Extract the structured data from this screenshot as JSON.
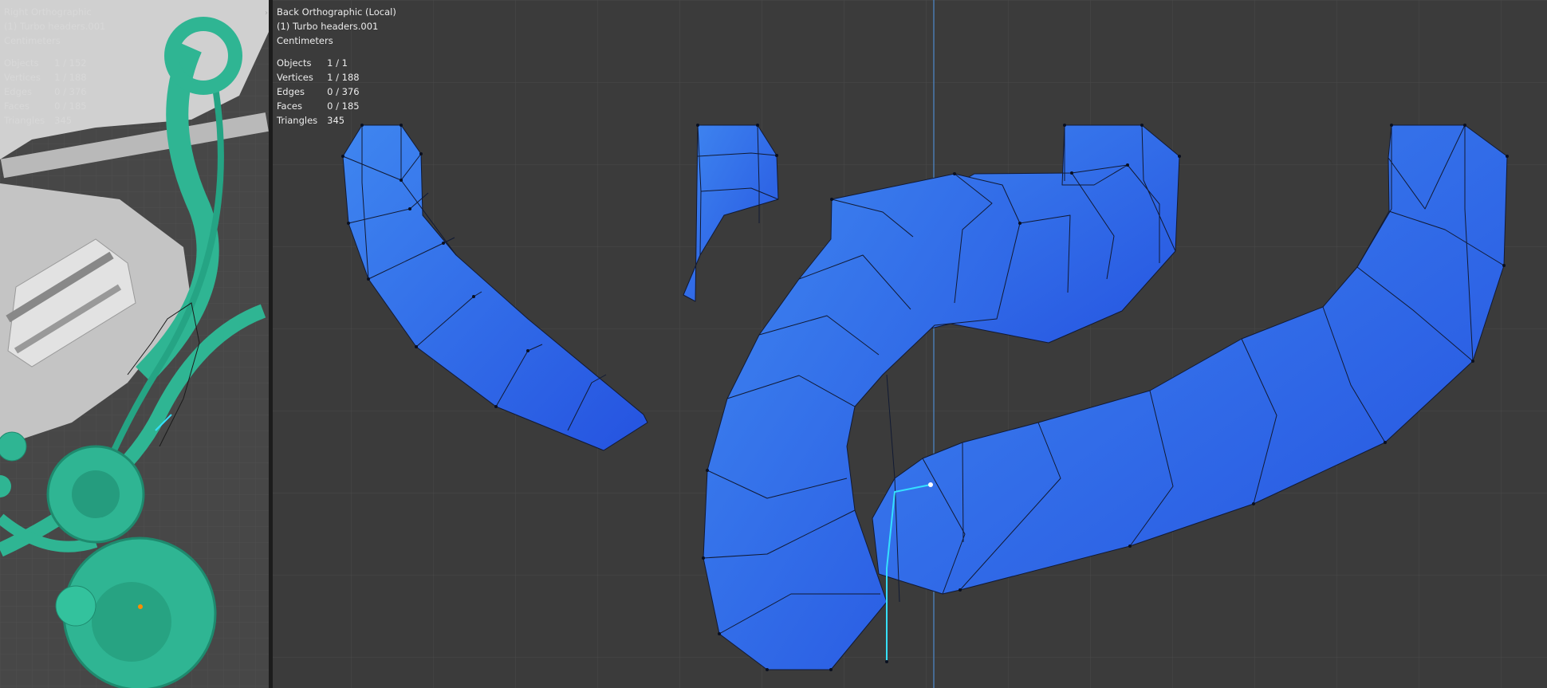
{
  "left_viewport": {
    "view_name": "Right Orthographic",
    "object_name": "(1) Turbo headers.001",
    "units": "Centimeters",
    "stats": [
      {
        "label": "Objects",
        "value": "1 / 152"
      },
      {
        "label": "Vertices",
        "value": "1 / 188"
      },
      {
        "label": "Edges",
        "value": "0 / 376"
      },
      {
        "label": "Faces",
        "value": "0 / 185"
      },
      {
        "label": "Triangles",
        "value": "345"
      }
    ]
  },
  "right_viewport": {
    "view_name": "Back Orthographic (Local)",
    "object_name": "(1) Turbo headers.001",
    "units": "Centimeters",
    "stats": [
      {
        "label": "Objects",
        "value": "1 / 1"
      },
      {
        "label": "Vertices",
        "value": "1 / 188"
      },
      {
        "label": "Edges",
        "value": "0 / 376"
      },
      {
        "label": "Faces",
        "value": "0 / 185"
      },
      {
        "label": "Triangles",
        "value": "345"
      }
    ]
  },
  "colors": {
    "viewport_bg": "#3b3b3b",
    "grid_line": "#4a4a4a",
    "grid_axis": "#4a7ab0",
    "mesh_fill": "#2e63e8",
    "mesh_highlight": "#3f86f0",
    "mesh_edge": "#111a33",
    "selected_edge": "#35e0ff",
    "engine_teal": "#2fb593",
    "engine_grey": "#c8c8c8"
  },
  "icons": {
    "split_handle": "chevron-right-icon"
  }
}
